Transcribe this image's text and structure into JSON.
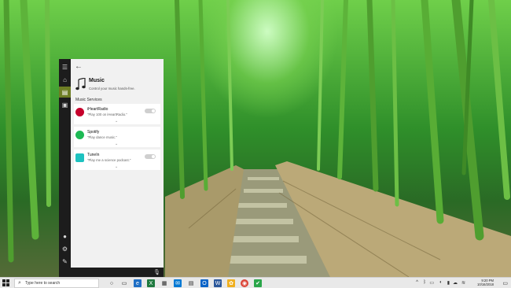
{
  "wallpaper": {
    "description_icon": "bamboo-forest-wallpaper"
  },
  "cortana": {
    "rail_icons": [
      "menu-icon",
      "home-icon",
      "notebook-icon",
      "devices-icon",
      "avatar-icon",
      "settings-icon",
      "feedback-icon"
    ],
    "back_label": "←",
    "header": {
      "title": "Music",
      "subtitle": "Control your music hands-free."
    },
    "section_label": "Music Services",
    "services": [
      {
        "name": "iHeartRadio",
        "example": "\"Play 100 on iHeartRadio.\"",
        "color": "#c6002b",
        "enabled": false
      },
      {
        "name": "Spotify",
        "example": "\"Play dance music.\"",
        "color": "#1db954",
        "enabled": false
      },
      {
        "name": "TuneIn",
        "example": "\"Play me a science podcast.\"",
        "color": "#1ec2c0",
        "enabled": false
      }
    ]
  },
  "taskbar": {
    "search_placeholder": "Type here to search",
    "apps": [
      "task-view-icon",
      "edge-icon",
      "excel-icon",
      "store-icon",
      "mail-icon",
      "outlook-icon",
      "word-icon",
      "paint-icon",
      "chrome-icon",
      "vpn-icon"
    ],
    "clock_time": "9:20 PM",
    "clock_date": "10/16/2018"
  }
}
